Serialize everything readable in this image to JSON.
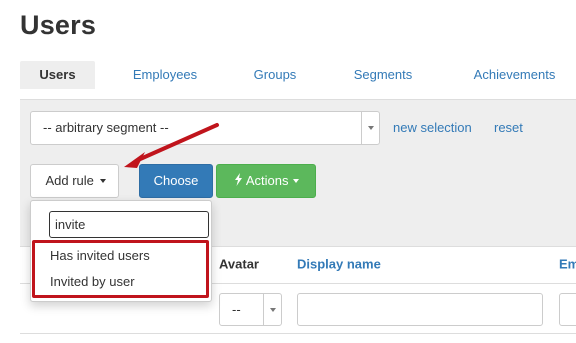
{
  "page": {
    "title": "Users"
  },
  "tabs": [
    {
      "label": "Users",
      "active": true
    },
    {
      "label": "Employees",
      "active": false
    },
    {
      "label": "Groups",
      "active": false
    },
    {
      "label": "Segments",
      "active": false
    },
    {
      "label": "Achievements",
      "active": false
    }
  ],
  "filter": {
    "segment_value": "-- arbitrary segment --",
    "new_selection_label": "new selection",
    "reset_label": "reset",
    "add_rule_label": "Add rule",
    "choose_label": "Choose",
    "actions_label": "Actions"
  },
  "dropdown": {
    "search_value": "invite",
    "items": [
      "Has invited users",
      "Invited by user"
    ]
  },
  "table": {
    "headers": {
      "avatar": "Avatar",
      "display_name": "Display name",
      "next": "Em"
    },
    "filters": {
      "avatar_value": "--"
    }
  },
  "colors": {
    "link": "#337ab7",
    "primary": "#337ab7",
    "success": "#5cb85c",
    "annotation": "#c0141c"
  },
  "icons": {
    "actions": "lightning-bolt-icon",
    "dropdown_caret": "caret-down-icon"
  }
}
